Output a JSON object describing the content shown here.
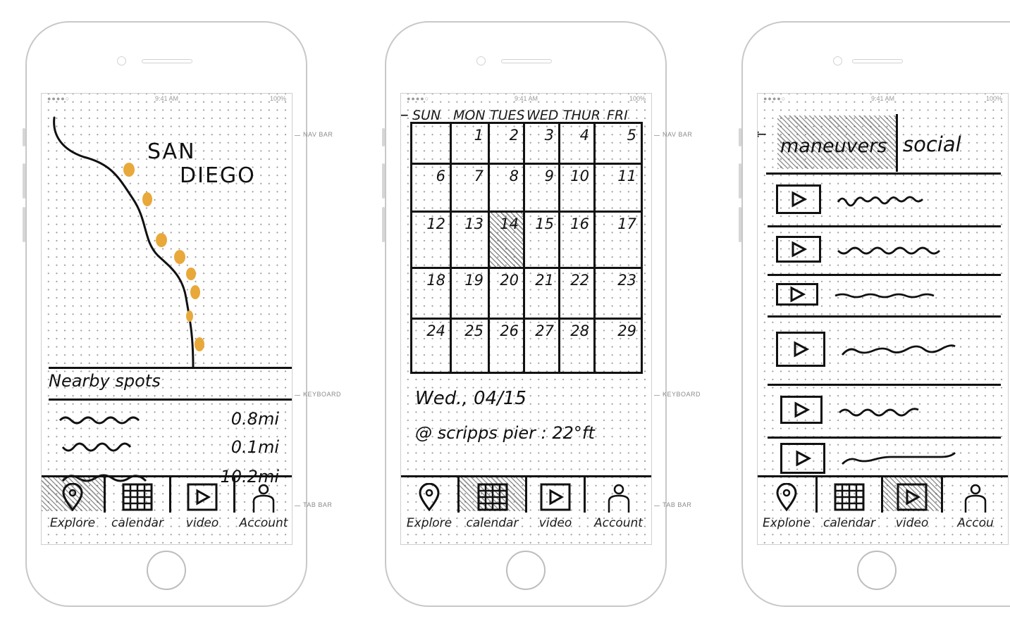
{
  "status": {
    "time": "9:41 AM",
    "battery": "100%",
    "signal": "●●●●○"
  },
  "annotations": {
    "nav_bar": "NAV BAR",
    "keyboard": "KEYBOARD",
    "tab_bar": "TAB BAR"
  },
  "tabs": [
    "Explore",
    "calendar",
    "video",
    "Account"
  ],
  "tabs_p2": [
    "Explore",
    "calendar",
    "video",
    "Account"
  ],
  "tabs_p3": [
    "Explone",
    "calendar",
    "video",
    "Accou"
  ],
  "phone1": {
    "city_line1": "SAN",
    "city_line2": "DIEGO",
    "section_title": "Nearby spots",
    "spots": [
      {
        "distance": "0.8mi"
      },
      {
        "distance": "0.1mi"
      },
      {
        "distance": "10.2mi"
      }
    ]
  },
  "phone2": {
    "back_arrow": "←",
    "days": [
      "SUN",
      "MON",
      "TUES",
      "WED",
      "THUR",
      "FRI"
    ],
    "weeks": [
      [
        "",
        "1",
        "2",
        "3",
        "4",
        "5"
      ],
      [
        "6",
        "7",
        "8",
        "9",
        "10",
        "11"
      ],
      [
        "12",
        "13",
        "14",
        "15",
        "16",
        "17"
      ],
      [
        "18",
        "19",
        "20",
        "21",
        "22",
        "23"
      ],
      [
        "24",
        "25",
        "26",
        "27",
        "28",
        "29"
      ]
    ],
    "selected_day": "14",
    "detail_date": "Wed., 04/15",
    "detail_location": "@ scripps pier : 22°ft"
  },
  "phone3": {
    "back_arrow": "←",
    "tab_active": "maneuvers",
    "tab_other": "social",
    "video_count": 6
  },
  "colors": {
    "ink": "#111111",
    "marker": "#e8a93a",
    "grid": "#9c9c9c",
    "frame": "#c8c8c8"
  }
}
